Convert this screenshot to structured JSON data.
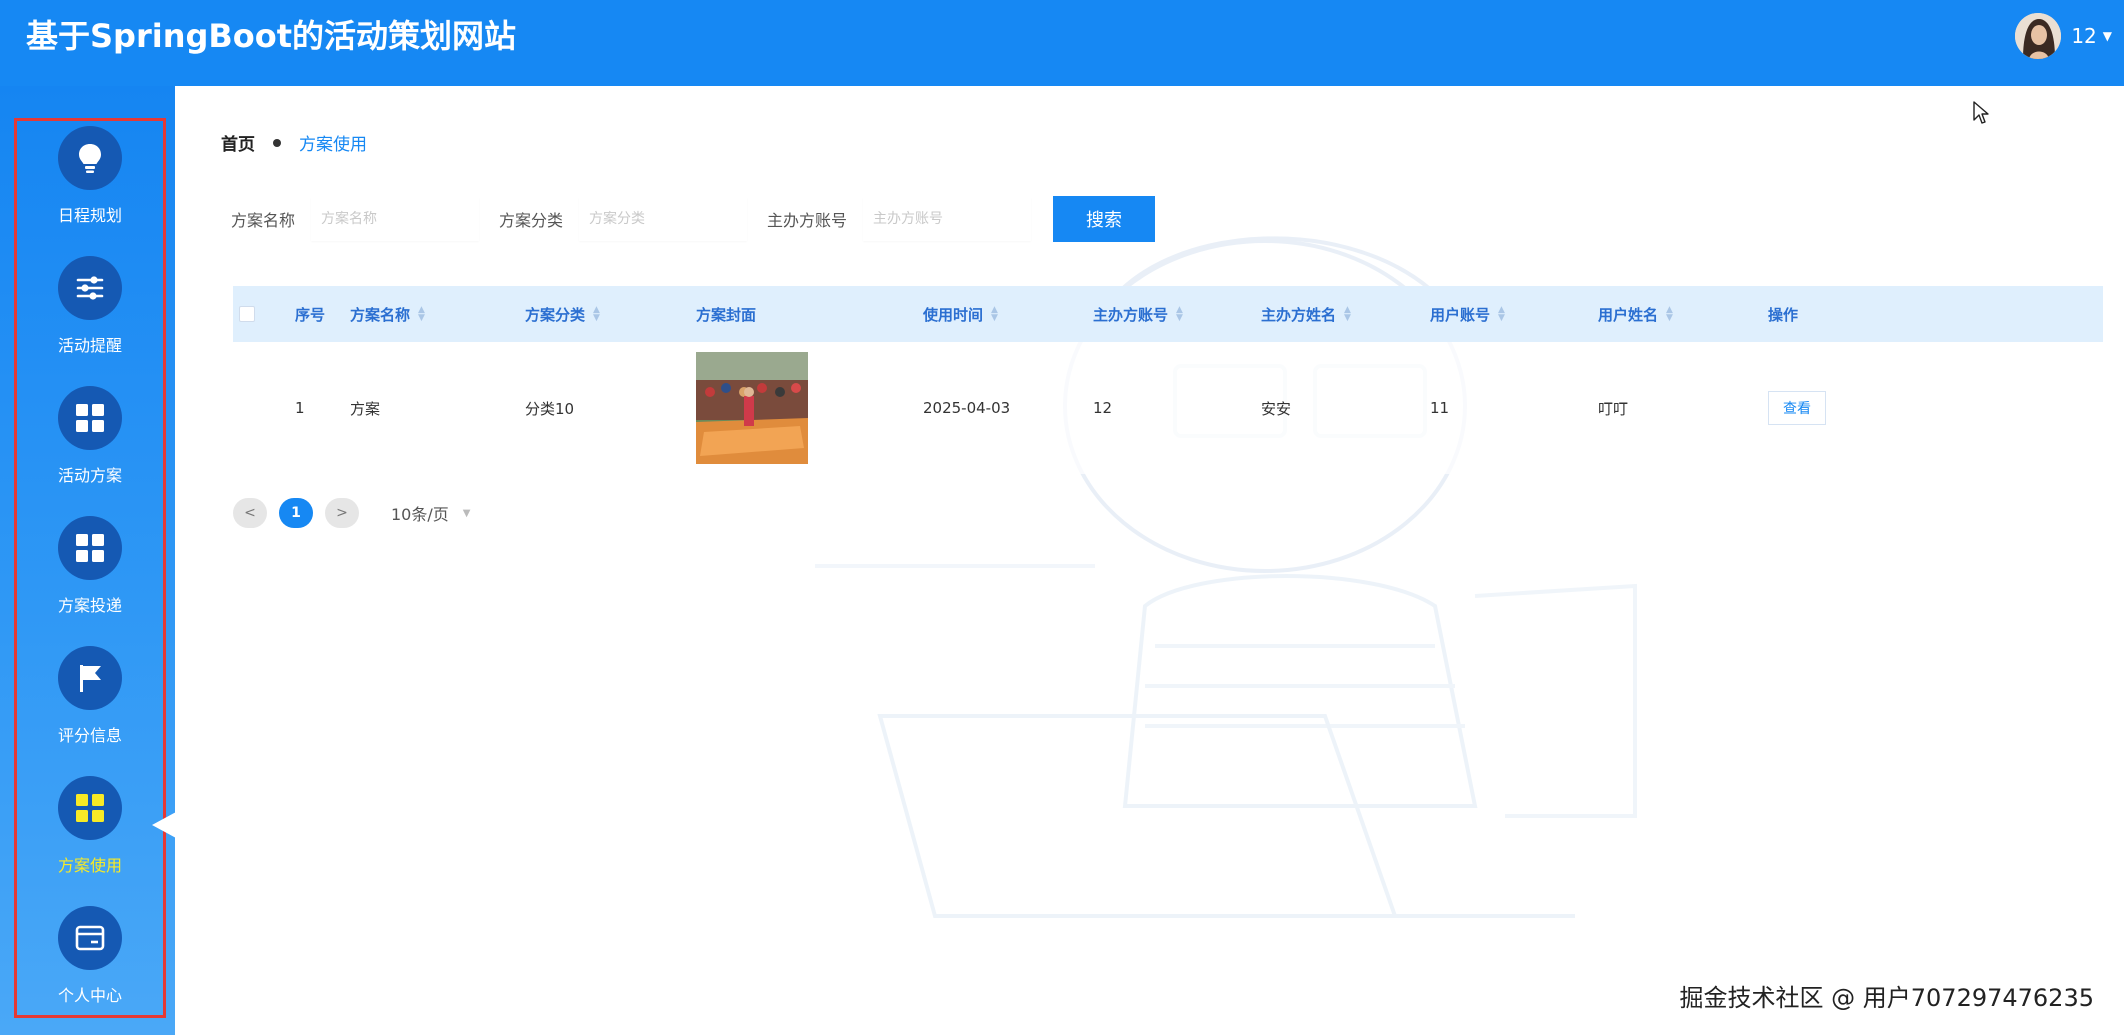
{
  "app": {
    "title": "基于SpringBoot的活动策划网站"
  },
  "user": {
    "name": "12"
  },
  "sidebar": {
    "items": [
      {
        "label": "日程规划",
        "icon": "lightbulb-icon",
        "active": false
      },
      {
        "label": "活动提醒",
        "icon": "sliders-icon",
        "active": false
      },
      {
        "label": "活动方案",
        "icon": "grid-icon",
        "active": false
      },
      {
        "label": "方案投递",
        "icon": "grid-icon",
        "active": false
      },
      {
        "label": "评分信息",
        "icon": "flag-icon",
        "active": false
      },
      {
        "label": "方案使用",
        "icon": "grid-icon",
        "active": true
      },
      {
        "label": "个人中心",
        "icon": "card-icon",
        "active": false
      }
    ]
  },
  "breadcrumb": {
    "home": "首页",
    "current": "方案使用"
  },
  "search": {
    "fields": [
      {
        "label": "方案名称",
        "placeholder": "方案名称"
      },
      {
        "label": "方案分类",
        "placeholder": "方案分类"
      },
      {
        "label": "主办方账号",
        "placeholder": "主办方账号"
      }
    ],
    "button_label": "搜索"
  },
  "table": {
    "columns": [
      "序号",
      "方案名称",
      "方案分类",
      "方案封面",
      "使用时间",
      "主办方账号",
      "主办方姓名",
      "用户账号",
      "用户姓名",
      "操作"
    ],
    "rows": [
      {
        "index": "1",
        "name": "方案",
        "category": "分类10",
        "use_time": "2025-04-03",
        "host_account": "12",
        "host_name": "安安",
        "user_account": "11",
        "user_name": "叮叮",
        "action": "查看"
      }
    ]
  },
  "pagination": {
    "prev": "<",
    "current": "1",
    "next": ">",
    "page_size": "10条/页"
  },
  "footer": {
    "watermark": "掘金技术社区 @ 用户707297476235"
  },
  "colors": {
    "primary": "#1688f3",
    "sidebar_circle": "#1559b3",
    "active_label": "#f7ea26",
    "highlight_frame": "#e53935",
    "table_header": "#dfeffd"
  }
}
